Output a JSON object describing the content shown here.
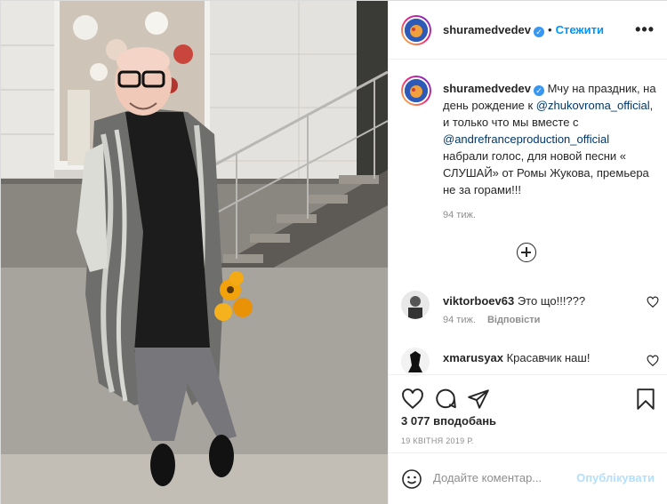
{
  "post": {
    "username": "shuramedvedev",
    "follow_label": "Стежити",
    "more_label": "•••",
    "caption": {
      "username": "shuramedvedev",
      "text_1": "Мчу на праздник, на день рождение к ",
      "mention_1": "@zhukovroma_official",
      "text_2": ", и только что мы вместе с ",
      "mention_2": "@andrefranceproduction_official",
      "text_3": " набрали голос, для новой песни « СЛУШАЙ» от Ромы Жукова, премьера не за горами!!!",
      "time": "94 тиж."
    },
    "comments": [
      {
        "username": "viktorboev63",
        "text": "Это що!!!???",
        "time": "94 тиж.",
        "reply": "Відповісти"
      },
      {
        "username": "xmarusyax",
        "text": "Красавчик наш!"
      }
    ],
    "likes": "3 077 вподобань",
    "date": "19 КВІТНЯ 2019 Р.",
    "add_comment_placeholder": "Додайте коментар...",
    "publish_label": "Опублікувати"
  },
  "colors": {
    "accent": "#0095f6",
    "verified": "#3897f0",
    "publish_disabled": "#b2dffc",
    "muted": "#8e8e8e"
  },
  "icons": {
    "header": [
      "avatar",
      "verified-badge-icon",
      "more-options-icon"
    ],
    "actions": [
      "heart-icon",
      "comment-icon",
      "share-icon",
      "bookmark-icon"
    ],
    "composer": [
      "emoji-icon"
    ]
  }
}
